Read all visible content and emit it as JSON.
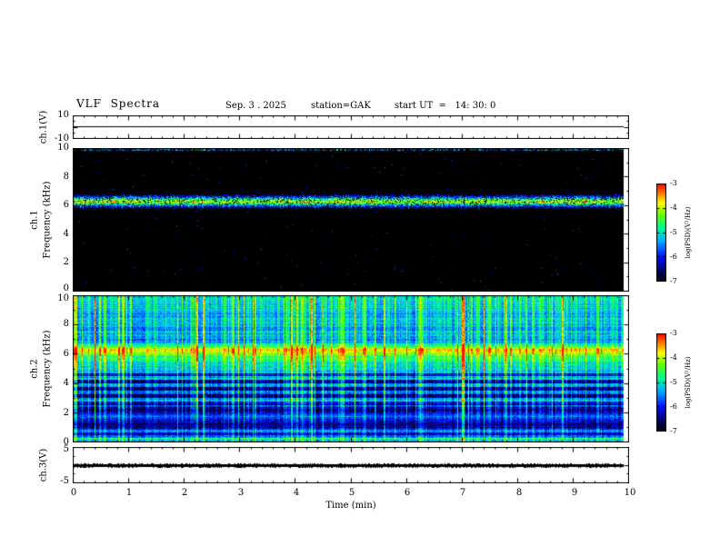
{
  "header": {
    "title": "VLF  Spectra",
    "date": "Sep. 3 . 2025",
    "station": "station=GAK",
    "start_ut": "start UT  =   14: 30: 0"
  },
  "axes": {
    "xlabel": "Time (min)",
    "x_ticks": [
      "0",
      "1",
      "2",
      "3",
      "4",
      "5",
      "6",
      "7",
      "8",
      "9",
      "10"
    ]
  },
  "colorbar": {
    "label": "log(PSD)(V²/Hz)",
    "ticks": [
      "-3",
      "-4",
      "-5",
      "-6",
      "-7"
    ]
  },
  "panels": {
    "ch1v": {
      "ylabel": "ch.1(V)",
      "yticks": [
        "10",
        "-10"
      ]
    },
    "spec1": {
      "ylabel_channel": "ch.1",
      "ylabel_axis": "Frequency (kHz)",
      "yticks": [
        "10",
        "8",
        "6",
        "4",
        "2",
        "0"
      ]
    },
    "spec2": {
      "ylabel_channel": "ch.2",
      "ylabel_axis": "Frequency (kHz)",
      "yticks": [
        "10",
        "8",
        "6",
        "4",
        "2",
        "0"
      ]
    },
    "ch3v": {
      "ylabel": "ch.3(V)",
      "yticks": [
        "5",
        "-5"
      ]
    }
  },
  "colormap": {
    "value_range": [
      -7,
      -3
    ],
    "stops": [
      {
        "t": 0.0,
        "color": "#000008"
      },
      {
        "t": 0.1,
        "color": "#000060"
      },
      {
        "t": 0.25,
        "color": "#0010ff"
      },
      {
        "t": 0.42,
        "color": "#00b4ff"
      },
      {
        "t": 0.55,
        "color": "#00ff90"
      },
      {
        "t": 0.68,
        "color": "#60ff00"
      },
      {
        "t": 0.8,
        "color": "#ffff00"
      },
      {
        "t": 0.9,
        "color": "#ff8000"
      },
      {
        "t": 1.0,
        "color": "#ff0000"
      }
    ]
  },
  "chart_data": [
    {
      "type": "line",
      "name": "ch.1 voltage waveform",
      "panel": "ch1v",
      "ylabel": "ch.1(V)",
      "ylim": [
        -10,
        10
      ],
      "xlim": [
        0,
        10
      ],
      "data_end_min": 9.9,
      "series": [
        {
          "name": "ch.1",
          "shape": "flat",
          "value_approx": 1.0
        }
      ]
    },
    {
      "type": "heatmap",
      "name": "ch.1 spectrogram",
      "panel": "spec1",
      "ylabel": "ch.1 Frequency (kHz)",
      "xlabel": "Time (min)",
      "ylim": [
        0,
        10
      ],
      "xlim": [
        0,
        10
      ],
      "zlabel": "log(PSD)(V²/Hz)",
      "zlim": [
        -7,
        -3
      ],
      "data_end_min": 9.9,
      "background_level": -7,
      "features": [
        {
          "kind": "horizontal-band",
          "center_khz": 6.3,
          "halfwidth_khz": 0.25,
          "level": -3.9
        },
        {
          "kind": "sparse-speckle",
          "density": 0.0045,
          "level_range": [
            -6.7,
            -5.6
          ]
        },
        {
          "kind": "top-edge-noise",
          "probability": 0.45,
          "level_range": [
            -6.3,
            -4.7
          ]
        }
      ]
    },
    {
      "type": "heatmap",
      "name": "ch.2 spectrogram",
      "panel": "spec2",
      "ylabel": "ch.2 Frequency (kHz)",
      "xlabel": "Time (min)",
      "ylim": [
        0,
        10
      ],
      "xlim": [
        0,
        10
      ],
      "zlabel": "log(PSD)(V²/Hz)",
      "zlim": [
        -7,
        -3
      ],
      "data_end_min": 9.9,
      "base_profile_khz_level": [
        [
          0,
          -5.0
        ],
        [
          0.3,
          -5.5
        ],
        [
          0.5,
          -6.4
        ],
        [
          0.7,
          -5.2
        ],
        [
          0.9,
          -6.3
        ],
        [
          1.2,
          -6.6
        ],
        [
          1.65,
          -5.7
        ],
        [
          2.1,
          -6.6
        ],
        [
          2.65,
          -5.5
        ],
        [
          3.3,
          -5.8
        ],
        [
          4.2,
          -5.6
        ],
        [
          5.2,
          -5.1
        ],
        [
          5.8,
          -4.6
        ],
        [
          6.3,
          -3.8
        ],
        [
          6.8,
          -5.4
        ],
        [
          8.0,
          -5.3
        ],
        [
          9.0,
          -5.2
        ],
        [
          10,
          -5.0
        ]
      ],
      "features": [
        {
          "kind": "horizontal-band",
          "center_khz": 6.3,
          "halfwidth_khz": 0.28,
          "level": -3.8
        },
        {
          "kind": "vertical-stripes",
          "strong_fraction": 0.1,
          "medium_fraction": 0.18,
          "boost_max": 1.8
        },
        {
          "kind": "horizontal-striations",
          "range_khz": [
            2.4,
            4.7
          ],
          "spacing_khz": 0.5,
          "depth": 0.75
        },
        {
          "kind": "bright-row",
          "center_khz": 0.15,
          "boost": 0.6
        }
      ]
    },
    {
      "type": "line",
      "name": "ch.3 voltage waveform",
      "panel": "ch3v",
      "ylabel": "ch.3(V)",
      "ylim": [
        -5,
        5
      ],
      "xlim": [
        0,
        10
      ],
      "data_end_min": 9.9,
      "series": [
        {
          "name": "ch.3",
          "shape": "flat-thick",
          "value_approx": 0.0
        }
      ]
    }
  ]
}
